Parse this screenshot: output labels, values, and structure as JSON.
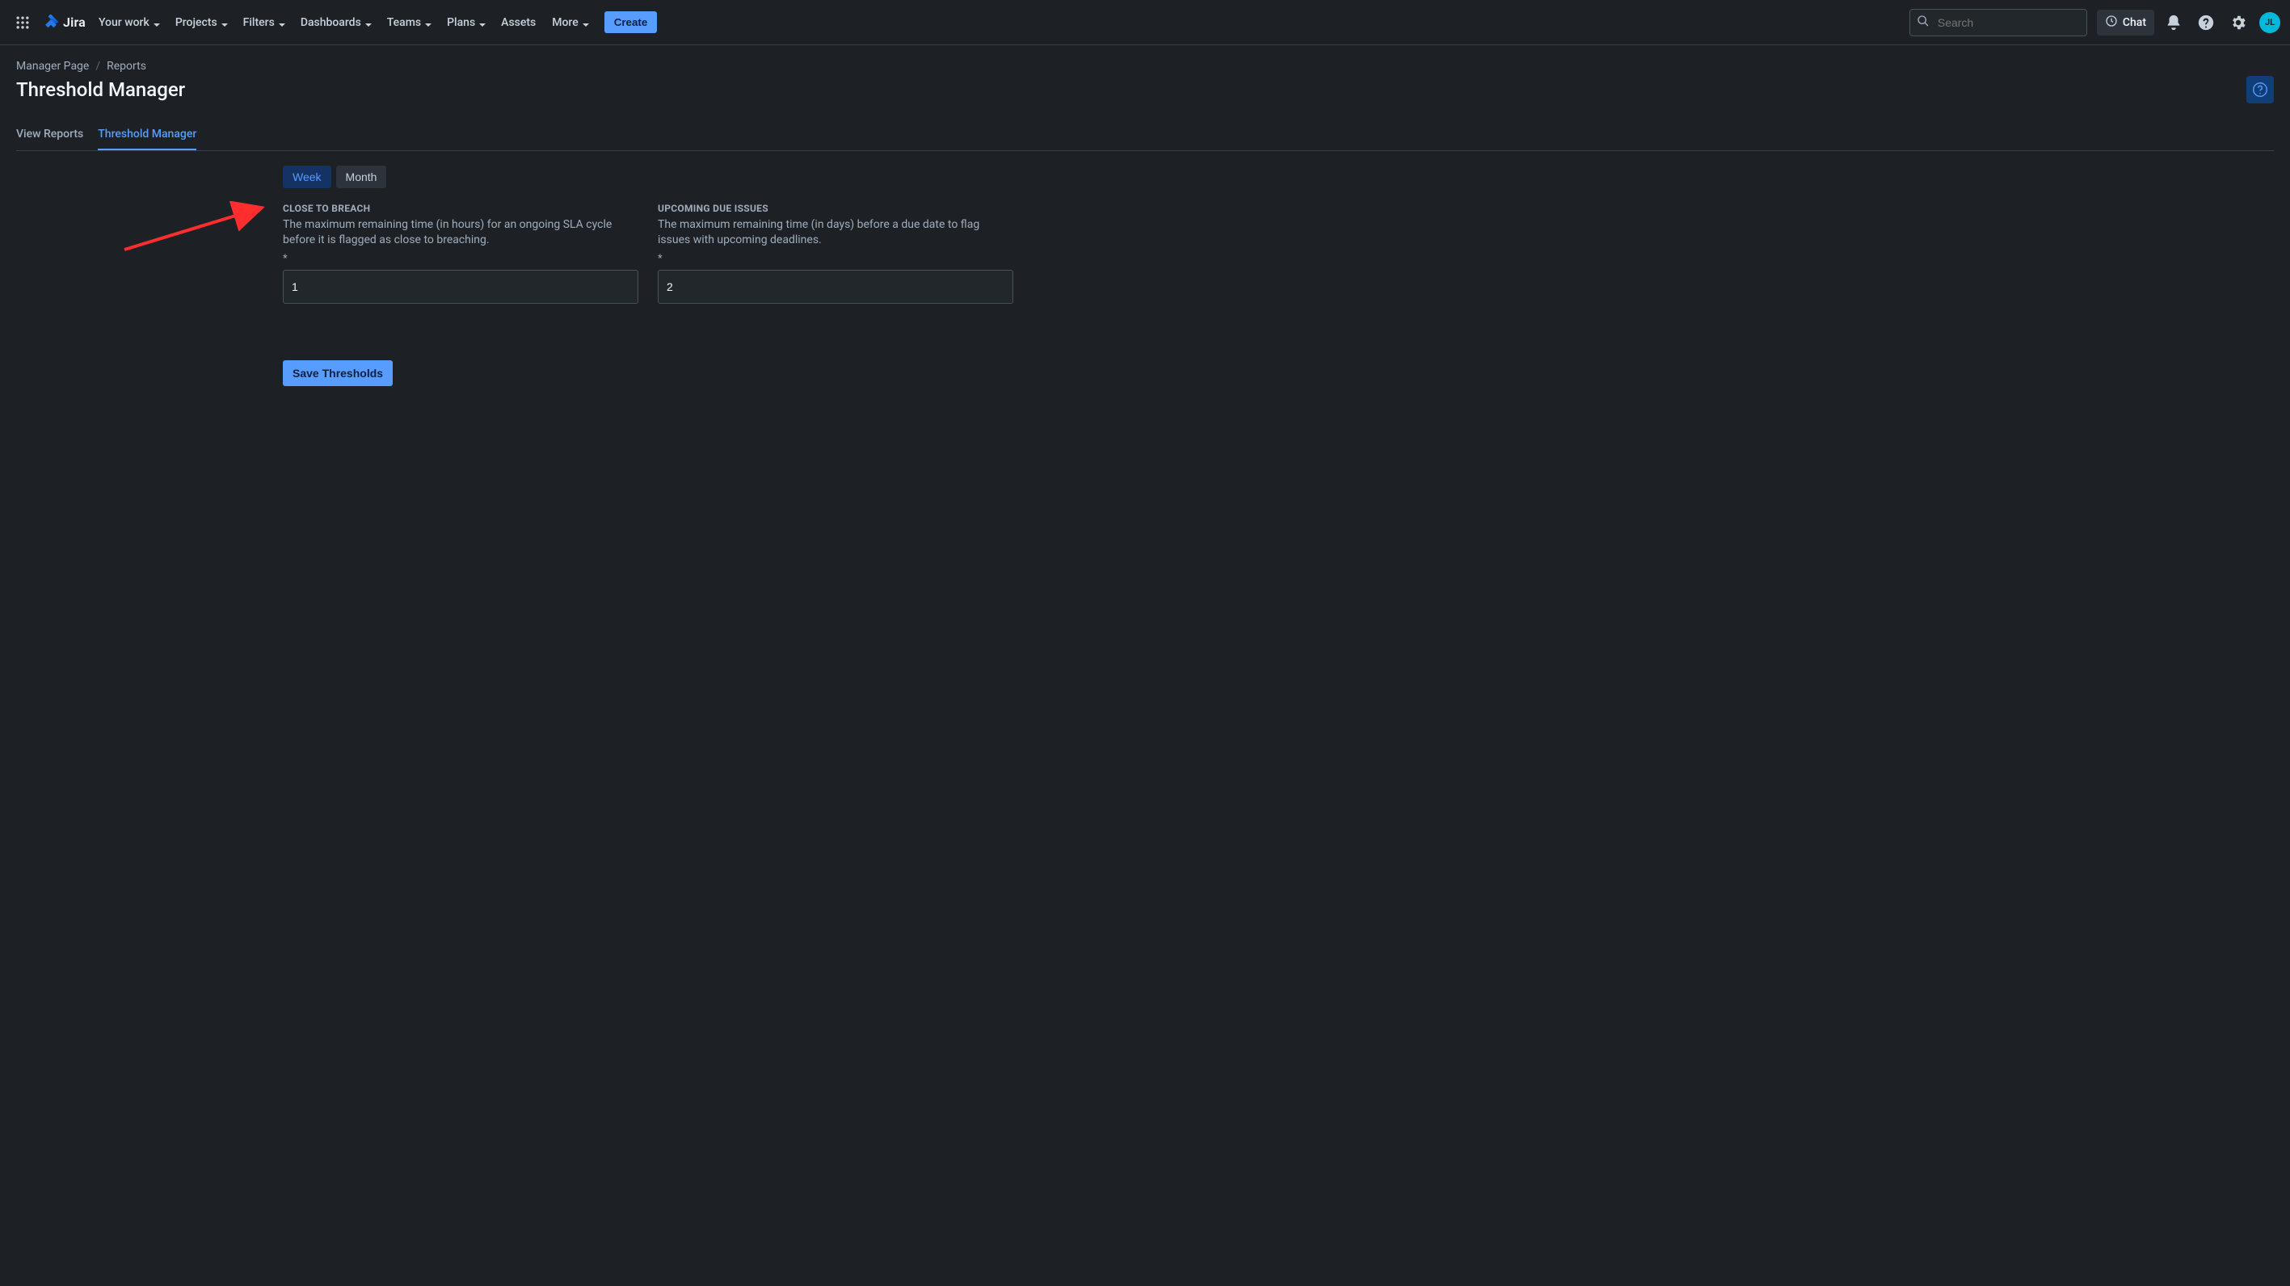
{
  "nav": {
    "logo_text": "Jira",
    "items": [
      {
        "label": "Your work",
        "has_menu": true
      },
      {
        "label": "Projects",
        "has_menu": true
      },
      {
        "label": "Filters",
        "has_menu": true
      },
      {
        "label": "Dashboards",
        "has_menu": true
      },
      {
        "label": "Teams",
        "has_menu": true
      },
      {
        "label": "Plans",
        "has_menu": true
      },
      {
        "label": "Assets",
        "has_menu": false
      },
      {
        "label": "More",
        "has_menu": true
      }
    ],
    "create_label": "Create",
    "search_placeholder": "Search",
    "chat_label": "Chat",
    "avatar_initials": "JL"
  },
  "breadcrumb": {
    "items": [
      "Manager Page",
      "Reports"
    ]
  },
  "page": {
    "title": "Threshold Manager"
  },
  "tabs": {
    "items": [
      {
        "label": "View Reports",
        "active": false
      },
      {
        "label": "Threshold Manager",
        "active": true
      }
    ]
  },
  "period": {
    "options": [
      {
        "label": "Week",
        "selected": true
      },
      {
        "label": "Month",
        "selected": false
      }
    ]
  },
  "fields": {
    "close_to_breach": {
      "title": "CLOSE TO BREACH",
      "description": "The maximum remaining time (in hours) for an ongoing SLA cycle before it is flagged as close to breaching.",
      "required_mark": "*",
      "value": "1"
    },
    "upcoming_due": {
      "title": "UPCOMING DUE ISSUES",
      "description": "The maximum remaining time (in days) before a due date to flag issues with upcoming deadlines.",
      "required_mark": "*",
      "value": "2"
    }
  },
  "actions": {
    "save_label": "Save Thresholds"
  }
}
